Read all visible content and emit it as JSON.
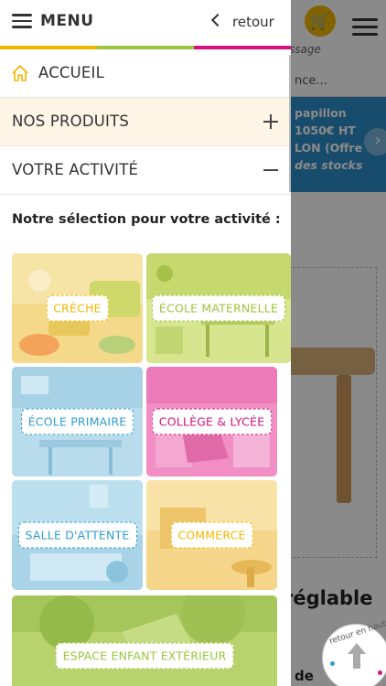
{
  "menu": {
    "title": "MENU",
    "back_label": "retour",
    "color_bar": [
      "#f2b600",
      "#9bc53d",
      "#d4117e"
    ],
    "items": [
      {
        "label": "ACCUEIL",
        "icon": "home-icon"
      },
      {
        "label": "NOS PRODUITS",
        "icon": "plus-icon"
      },
      {
        "label": "VOTRE ACTIVITÉ",
        "icon": "minus-icon"
      }
    ],
    "section_title": "Notre sélection pour votre activité :",
    "activities": [
      {
        "label": "CRÈCHE",
        "color": "#f2b600"
      },
      {
        "label": "ÉCOLE MATERNELLE",
        "color": "#9bc53d"
      },
      {
        "label": "ÉCOLE PRIMAIRE",
        "color": "#2e9ccf"
      },
      {
        "label": "COLLÈGE & LYCÉE",
        "color": "#d4117e"
      },
      {
        "label": "SALLE D'ATTENTE",
        "color": "#2e9ccf"
      },
      {
        "label": "COMMERCE",
        "color": "#f2b600"
      },
      {
        "label": "ESPACE ENFANT EXTÉRIEUR",
        "color": "#9bc53d"
      }
    ]
  },
  "background": {
    "panier_label": "ssage",
    "search_placeholder": "nce...",
    "banner_lines": [
      "papillon",
      "1050€ HT",
      "LON (Offre",
      "des stocks"
    ],
    "product_title": "réglable",
    "product_sub": "de"
  },
  "back_to_top": {
    "label": "retour en haut"
  }
}
